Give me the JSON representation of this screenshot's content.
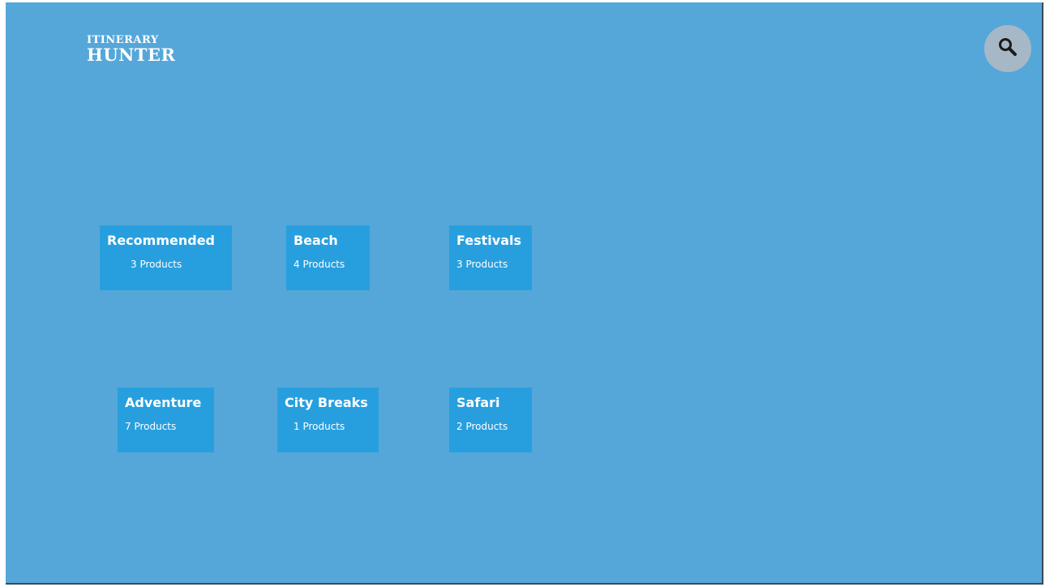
{
  "logo": {
    "line1": "ITINERARY",
    "line2": "HUNTER"
  },
  "search": {
    "icon": "search-icon"
  },
  "categories": [
    {
      "title": "Recommended",
      "count": "3  Products"
    },
    {
      "title": "Beach",
      "count": "4  Products"
    },
    {
      "title": "Festivals",
      "count": "3  Products"
    },
    {
      "title": "Adventure",
      "count": "7  Products"
    },
    {
      "title": "City Breaks",
      "count": "1  Products"
    },
    {
      "title": "Safari",
      "count": "2  Products"
    }
  ],
  "colors": {
    "background": "#55a7d9",
    "tile": "#279fdf",
    "search_button": "#a6b8c6",
    "text": "#ffffff"
  }
}
